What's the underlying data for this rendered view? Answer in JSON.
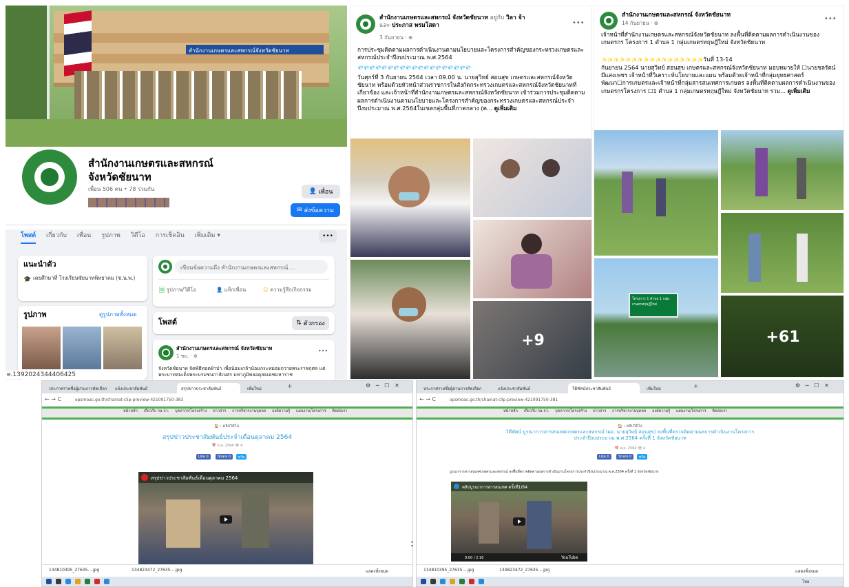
{
  "profile": {
    "name_line1": "สำนักงานเกษตรและสหกรณ์",
    "name_line2": "จังหวัดชัยนาท",
    "stats": "เพื่อน 506 คน • 78 ร่วมกัน",
    "building_sign": "สำนักงานเกษตรและสหกรณ์จังหวัดชัยนาท",
    "friend_button": "เพื่อน",
    "message_button": "ส่งข้อความ",
    "more_button": "•••",
    "tabs": [
      "โพสต์",
      "เกี่ยวกับ",
      "เพื่อน",
      "รูปภาพ",
      "วิดีโอ",
      "การเช็คอิน",
      "เพิ่มเติม ▾"
    ],
    "intro_title": "แนะนำตัว",
    "intro_text": "เคยศึกษาที่ โรงเรียนชัยนาทพิทยาคม (ช.น.พ.)",
    "photos_title": "รูปภาพ",
    "photos_link": "ดูรูปภาพทั้งหมด",
    "composer_placeholder": "เขียนข้อความถึง สำนักงานเกษตรและสหกรณ์ ...",
    "composer_actions": [
      "รูปภาพ/วิดีโอ",
      "แท็กเพื่อน",
      "ความรู้สึก/กิจกรรม"
    ],
    "posts_title": "โพสต์",
    "filter_button": "ตัวกรอง",
    "post_author": "สำนักงานเกษตรและสหกรณ์ จังหวัดชัยนาท",
    "post_time": "1 ชม. · ⊕",
    "post_text": "จังหวัดชัยนาท จัดพิธีทอดผ้าป่า เพื่อน้อมเกล้าน้อมกระหม่อมถวายพระราชกุศล แด่ พระบาทสมเด็จพระบรมชนกาธิเบศร มหาภูมิพลอดุลยเดชมหาราช",
    "file_caption": "e.1392024344406425"
  },
  "post_middle": {
    "author": "สำนักงานเกษตรและสหกรณ์ จังหวัดชัยนาท",
    "with_text": " อยู่กับ ",
    "with_name": "วิลา จ้า",
    "and_text": "และ ",
    "and_name": "ประภาส พรมโสดา",
    "time": "3 กันยายน · ⊕",
    "more_button": "•••",
    "text": "การประชุมติดตามผลการดำเนินงานตามนโยบายและโครงการสำคัญของกระทรวงเกษตรและสหกรณ์ประจำปีงบประมาณ พ.ศ.2564",
    "diamonds": "💎💎💎💎💎💎💎💎💎💎💎💎💎💎💎💎💎💎💎",
    "body": "วันศุกร์ที่ 3 กันยายน 2564 เวลา 09.00 น. นายสุวิทย์ สอนสุข เกษตรและสหกรณ์จังหวัดชัยนาท พร้อมด้วยหัวหน้าส่วนราชการในสังกัดกระทรวงเกษตรและสหกรณ์จังหวัดชัยนาทที่เกี่ยวข้อง และเจ้าหน้าที่สำนักงานเกษตรและสหกรณ์จังหวัดชัยนาท เข้าร่วมการประชุมติดตามผลการดำเนินงานตามนโยบายและโครงการสำคัญของกระทรวงเกษตรและสหกรณ์ประจำปีงบประมาณ พ.ศ.2564ในเขตกลุ่มพื้นที่ภาคกลาง (ค...",
    "see_more": "ดูเพิ่มเติม",
    "extra_count": "+9"
  },
  "post_right": {
    "author": "สำนักงานเกษตรและสหกรณ์ จังหวัดชัยนาท",
    "time": "14 กันยายน · ⊕",
    "more_button": "•••",
    "text1": "เจ้าหน้าที่สำนักงานเกษตรและสหกรณ์จังหวัดชัยนาท ลงพื้นที่ติดตามผลการดำเนินงานของเกษตรกร โครงการ 1 ตำบล 1 กลุ่มเกษตรทฤษฎีใหม่ จังหวัดชัยนาท",
    "sparkles": "✨✨✨✨✨✨✨✨✨✨✨✨✨✨✨✨✨",
    "text2_head": "วันที่ 13-14",
    "text2": "กันยายน 2564 นายสุวิทย์ สอนสุข เกษตรและสหกรณ์จังหวัดชัยนาท มอบหมายให้ ☐นายชลรัตน์ มีแสงเพชร เจ้าหน้าที่วิเคราะห์นโยบายและแผน พร้อมด้วยเจ้าหน้าที่กลุ่มยุทธศาสตร์พัฒนา☐การเกษตรและเจ้าหน้าที่กลุ่มสารสนเทศการเกษตร ลงพื้นที่ติดตามผลการดำเนินงานของเกษตรกรโครงการ ☐1 ตำบล 1 กลุ่มเกษตรทฤษฎีใหม่ จังหวัดชัยนาท รวม...",
    "see_more": "ดูเพิ่มเติม",
    "sign_text": "โครงการ 1 ตำบล 1 กลุ่มเกษตรทฤษฎีใหม่",
    "extra_count": "+61"
  },
  "browser_left": {
    "tabs": [
      "ประกาศรายชื่อผู้ผ่านการคัดเลือก",
      "แจ้งประชาสัมพันธ์",
      "สรุปข่าวประชาสัมพันธ์",
      "เพิ่มใหม่"
    ],
    "url": "opsmoac.go.th/chainat-clip-preview-421091750-383",
    "nav": [
      "หน้าหลัก",
      "เกี่ยวกับ กษ.จว.",
      "บุคลากร/โครงสร้าง",
      "ข่าวสาร",
      "การบริหารงานบุคคล",
      "องค์ความรู้",
      "แผนงาน/โครงการ",
      "ติดต่อเรา"
    ],
    "breadcrumb": "🏠 › คลิปวิดีโอ",
    "title": "สรุปข่าวประชาสัมพันธ์ประจำเดือนตุลาคม 2564",
    "meta": "📅 ต.ค. 2564   👁 4",
    "share": [
      "Like 0",
      "Share 0",
      "ทวีต"
    ],
    "video_title": "สรุปข่าวประชาสัมพันธ์เดือนตุลาคม 2564",
    "downloads": [
      "134810395_27635....jpg",
      "134823472_27635....jpg"
    ],
    "show_all": "แสดงทั้งหมด",
    "controls": [
      "─",
      "☐",
      "✕"
    ]
  },
  "browser_right": {
    "tabs": [
      "ประกาศรายชื่อผู้ผ่านการคัดเลือก",
      "แจ้งประชาสัมพันธ์",
      "วีดิทัศน์ประชาสัมพันธ์",
      "เพิ่มใหม่"
    ],
    "url": "opsmoac.go.th/chainat-clip-preview-421091750-381",
    "nav": [
      "หน้าหลัก",
      "เกี่ยวกับ กษ.จว.",
      "บุคลากร/โครงสร้าง",
      "ข่าวสาร",
      "การบริหารงานบุคคล",
      "องค์ความรู้",
      "แผนงาน/โครงการ",
      "ติดต่อเรา"
    ],
    "breadcrumb": "🏠 › คลิปวิดีโอ",
    "title": "วิดีทัศน์ บูรณาการสารสนเทศเกษตรและสหกรณ์ (ผอ. นายสุวิทย์ สอนสุข) ลงพื้นที่ตรวจติดตามผลการดำเนินงานโครงการประจำปีงบประมาณ พ.ศ.2564 ครั้งที่ 1 จังหวัดชัยนาท",
    "meta": "📅 ส.ค. 2564   👁 4",
    "share": [
      "Like 0",
      "Share 0",
      "ทวีต"
    ],
    "description": "บูรณาการสารสนเทศเกษตรและสหกรณ์ ลงพื้นที่ตรวจติดตามผลการดำเนินงานโครงการประจำปีงบประมาณ พ.ศ.2564 ครั้งที่ 1 จังหวัดชัยนาท",
    "video_title": "คลิปบูรณาการสารสนเทศ ครั้งที่1/64",
    "video_time": "0:00 / 2:16",
    "youtube": "YouTube",
    "downloads": [
      "134810395_27635....jpg",
      "134823472_27635....jpg"
    ],
    "show_all": "แสดงทั้งหมด",
    "controls": [
      "─",
      "☐",
      "✕"
    ],
    "tray_time": "ไทย"
  },
  "separator": ":"
}
